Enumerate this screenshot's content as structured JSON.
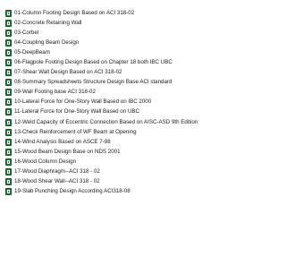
{
  "files": [
    {
      "label": "01-Column Footing Design Based on ACI 318-02",
      "icon": "excel-file-icon"
    },
    {
      "label": "02-Concrete Retaining Wall",
      "icon": "excel-file-icon"
    },
    {
      "label": "03-Corbel",
      "icon": "excel-file-icon"
    },
    {
      "label": "04-Coupling Beam Design",
      "icon": "excel-file-icon"
    },
    {
      "label": "05-DeepBeam",
      "icon": "excel-file-icon"
    },
    {
      "label": "06-Flagpole Footing Design Based on Chapter 18 both IBC UBC",
      "icon": "excel-file-icon"
    },
    {
      "label": "07-Shear Wall Design Based on ACI 318-02",
      "icon": "excel-file-icon"
    },
    {
      "label": "08-Summary Spreadsheets Structure Design Base ACI standard",
      "icon": "excel-file-icon"
    },
    {
      "label": "09-Wall Footing base ACI 318-02",
      "icon": "excel-file-icon"
    },
    {
      "label": "10-Lateral Force for One-Story Wall Based on IBC 2000",
      "icon": "excel-file-icon"
    },
    {
      "label": "11-Lateral Force for One-Story Wall Based on UBC",
      "icon": "excel-file-icon"
    },
    {
      "label": "12-Weld Capacity of Eccentric Connection Based on AISC-ASD 9th Edition",
      "icon": "excel-file-icon"
    },
    {
      "label": "13-Check Reinforcement of WF Beam at Opening",
      "icon": "excel-file-icon"
    },
    {
      "label": "14-Wind Analysis Based on ASCE 7-98",
      "icon": "excel-file-icon"
    },
    {
      "label": "15-Wood Beam Design Base on NDS 2001",
      "icon": "excel-file-icon"
    },
    {
      "label": "16-Wood Column Design",
      "icon": "excel-file-icon"
    },
    {
      "label": "17-Wood Diaphragm--ACI 318 - 02",
      "icon": "excel-file-icon"
    },
    {
      "label": "18-Wood Shear Wall--ACI 318 - 02",
      "icon": "excel-file-icon"
    },
    {
      "label": "19-Slab Punching Design According ACI318-08",
      "icon": "excel-file-icon"
    }
  ]
}
